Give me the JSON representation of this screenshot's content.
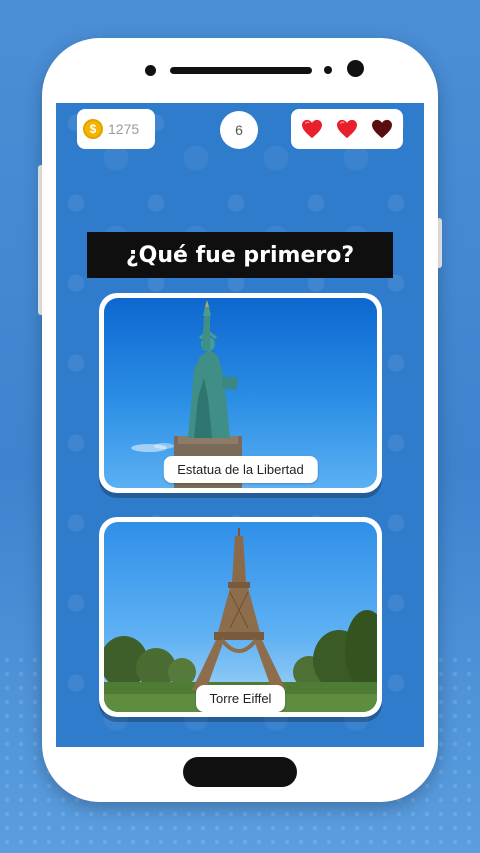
{
  "header": {
    "coins": "1275",
    "coin_symbol": "$",
    "level": "6",
    "lives": [
      {
        "icon": "heart-full-icon",
        "color": "#e8202e"
      },
      {
        "icon": "heart-full-icon",
        "color": "#e8202e"
      },
      {
        "icon": "heart-empty-icon",
        "color": "#5a0f0f"
      }
    ]
  },
  "question": {
    "text": "¿Qué fue primero?"
  },
  "options": [
    {
      "label": "Estatua de la Libertad",
      "image": "statue-of-liberty-photo"
    },
    {
      "label": "Torre Eiffel",
      "image": "eiffel-tower-photo"
    }
  ],
  "colors": {
    "screen_background": "#2f7bcc",
    "banner": "#0f0f0f",
    "coin": "#f4b400"
  }
}
